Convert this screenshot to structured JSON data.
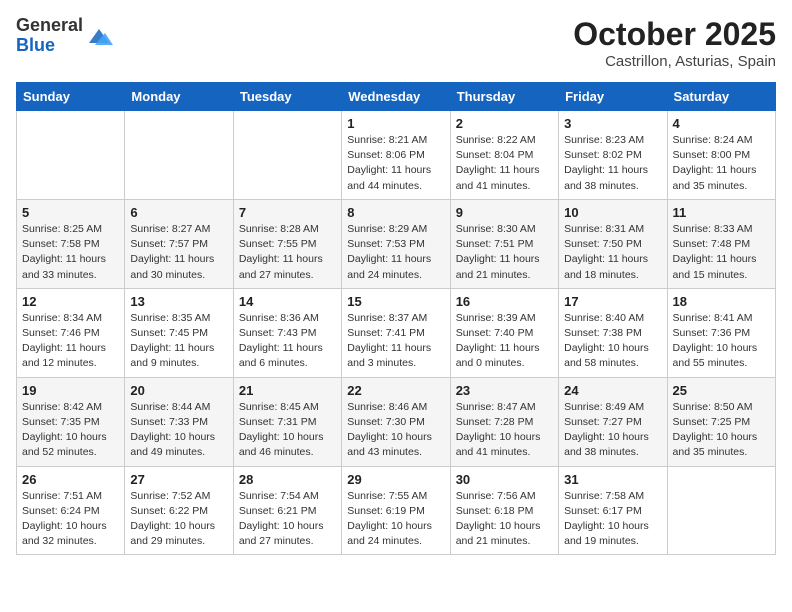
{
  "logo": {
    "general": "General",
    "blue": "Blue"
  },
  "title": "October 2025",
  "location": "Castrillon, Asturias, Spain",
  "weekdays": [
    "Sunday",
    "Monday",
    "Tuesday",
    "Wednesday",
    "Thursday",
    "Friday",
    "Saturday"
  ],
  "weeks": [
    [
      {
        "day": "",
        "info": ""
      },
      {
        "day": "",
        "info": ""
      },
      {
        "day": "",
        "info": ""
      },
      {
        "day": "1",
        "info": "Sunrise: 8:21 AM\nSunset: 8:06 PM\nDaylight: 11 hours and 44 minutes."
      },
      {
        "day": "2",
        "info": "Sunrise: 8:22 AM\nSunset: 8:04 PM\nDaylight: 11 hours and 41 minutes."
      },
      {
        "day": "3",
        "info": "Sunrise: 8:23 AM\nSunset: 8:02 PM\nDaylight: 11 hours and 38 minutes."
      },
      {
        "day": "4",
        "info": "Sunrise: 8:24 AM\nSunset: 8:00 PM\nDaylight: 11 hours and 35 minutes."
      }
    ],
    [
      {
        "day": "5",
        "info": "Sunrise: 8:25 AM\nSunset: 7:58 PM\nDaylight: 11 hours and 33 minutes."
      },
      {
        "day": "6",
        "info": "Sunrise: 8:27 AM\nSunset: 7:57 PM\nDaylight: 11 hours and 30 minutes."
      },
      {
        "day": "7",
        "info": "Sunrise: 8:28 AM\nSunset: 7:55 PM\nDaylight: 11 hours and 27 minutes."
      },
      {
        "day": "8",
        "info": "Sunrise: 8:29 AM\nSunset: 7:53 PM\nDaylight: 11 hours and 24 minutes."
      },
      {
        "day": "9",
        "info": "Sunrise: 8:30 AM\nSunset: 7:51 PM\nDaylight: 11 hours and 21 minutes."
      },
      {
        "day": "10",
        "info": "Sunrise: 8:31 AM\nSunset: 7:50 PM\nDaylight: 11 hours and 18 minutes."
      },
      {
        "day": "11",
        "info": "Sunrise: 8:33 AM\nSunset: 7:48 PM\nDaylight: 11 hours and 15 minutes."
      }
    ],
    [
      {
        "day": "12",
        "info": "Sunrise: 8:34 AM\nSunset: 7:46 PM\nDaylight: 11 hours and 12 minutes."
      },
      {
        "day": "13",
        "info": "Sunrise: 8:35 AM\nSunset: 7:45 PM\nDaylight: 11 hours and 9 minutes."
      },
      {
        "day": "14",
        "info": "Sunrise: 8:36 AM\nSunset: 7:43 PM\nDaylight: 11 hours and 6 minutes."
      },
      {
        "day": "15",
        "info": "Sunrise: 8:37 AM\nSunset: 7:41 PM\nDaylight: 11 hours and 3 minutes."
      },
      {
        "day": "16",
        "info": "Sunrise: 8:39 AM\nSunset: 7:40 PM\nDaylight: 11 hours and 0 minutes."
      },
      {
        "day": "17",
        "info": "Sunrise: 8:40 AM\nSunset: 7:38 PM\nDaylight: 10 hours and 58 minutes."
      },
      {
        "day": "18",
        "info": "Sunrise: 8:41 AM\nSunset: 7:36 PM\nDaylight: 10 hours and 55 minutes."
      }
    ],
    [
      {
        "day": "19",
        "info": "Sunrise: 8:42 AM\nSunset: 7:35 PM\nDaylight: 10 hours and 52 minutes."
      },
      {
        "day": "20",
        "info": "Sunrise: 8:44 AM\nSunset: 7:33 PM\nDaylight: 10 hours and 49 minutes."
      },
      {
        "day": "21",
        "info": "Sunrise: 8:45 AM\nSunset: 7:31 PM\nDaylight: 10 hours and 46 minutes."
      },
      {
        "day": "22",
        "info": "Sunrise: 8:46 AM\nSunset: 7:30 PM\nDaylight: 10 hours and 43 minutes."
      },
      {
        "day": "23",
        "info": "Sunrise: 8:47 AM\nSunset: 7:28 PM\nDaylight: 10 hours and 41 minutes."
      },
      {
        "day": "24",
        "info": "Sunrise: 8:49 AM\nSunset: 7:27 PM\nDaylight: 10 hours and 38 minutes."
      },
      {
        "day": "25",
        "info": "Sunrise: 8:50 AM\nSunset: 7:25 PM\nDaylight: 10 hours and 35 minutes."
      }
    ],
    [
      {
        "day": "26",
        "info": "Sunrise: 7:51 AM\nSunset: 6:24 PM\nDaylight: 10 hours and 32 minutes."
      },
      {
        "day": "27",
        "info": "Sunrise: 7:52 AM\nSunset: 6:22 PM\nDaylight: 10 hours and 29 minutes."
      },
      {
        "day": "28",
        "info": "Sunrise: 7:54 AM\nSunset: 6:21 PM\nDaylight: 10 hours and 27 minutes."
      },
      {
        "day": "29",
        "info": "Sunrise: 7:55 AM\nSunset: 6:19 PM\nDaylight: 10 hours and 24 minutes."
      },
      {
        "day": "30",
        "info": "Sunrise: 7:56 AM\nSunset: 6:18 PM\nDaylight: 10 hours and 21 minutes."
      },
      {
        "day": "31",
        "info": "Sunrise: 7:58 AM\nSunset: 6:17 PM\nDaylight: 10 hours and 19 minutes."
      },
      {
        "day": "",
        "info": ""
      }
    ]
  ]
}
